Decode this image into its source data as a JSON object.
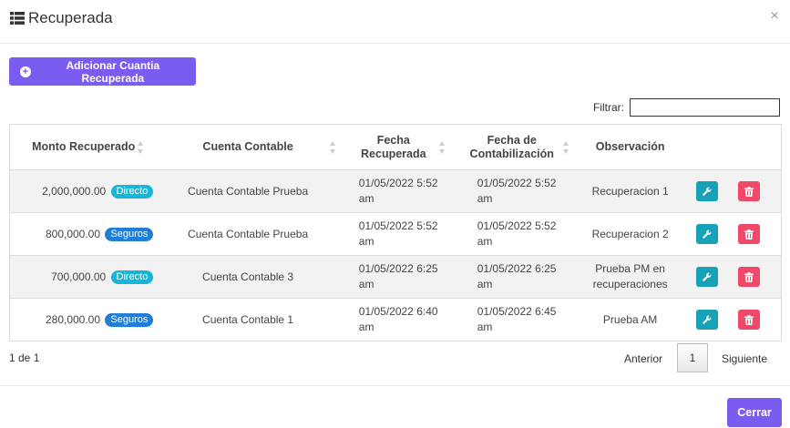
{
  "modal": {
    "title": "Recuperada",
    "title_icon": "list-icon",
    "close_glyph": "×"
  },
  "toolbar": {
    "add_label": "Adicionar Cuantia Recuperada",
    "add_icon": "plus-circle-icon"
  },
  "filter": {
    "label": "Filtrar:",
    "value": ""
  },
  "table": {
    "headers": {
      "monto": "Monto Recuperado",
      "cuenta": "Cuenta Contable",
      "fecha_rec": "Fecha Recuperada",
      "fecha_cont": "Fecha de Contabilización",
      "obs": "Observación"
    },
    "rows": [
      {
        "monto": "2,000,000.00",
        "tipo": "Directo",
        "cuenta": "Cuenta Contable Prueba",
        "fecha_rec": "01/05/2022 5:52 am",
        "fecha_cont": "01/05/2022 5:52 am",
        "obs": "Recuperacion 1"
      },
      {
        "monto": "800,000.00",
        "tipo": "Seguros",
        "cuenta": "Cuenta Contable Prueba",
        "fecha_rec": "01/05/2022 5:52 am",
        "fecha_cont": "01/05/2022 5:52 am",
        "obs": "Recuperacion 2"
      },
      {
        "monto": "700,000.00",
        "tipo": "Directo",
        "cuenta": "Cuenta Contable 3",
        "fecha_rec": "01/05/2022 6:25 am",
        "fecha_cont": "01/05/2022 6:25 am",
        "obs": "Prueba PM en recuperaciones"
      },
      {
        "monto": "280,000.00",
        "tipo": "Seguros",
        "cuenta": "Cuenta Contable 1",
        "fecha_rec": "01/05/2022 6:40 am",
        "fecha_cont": "01/05/2022 6:45 am",
        "obs": "Prueba AM"
      }
    ],
    "row_actions": {
      "edit_icon": "wrench-icon",
      "delete_icon": "trash-icon"
    }
  },
  "pagination": {
    "info": "1 de 1",
    "prev_label": "Anterior",
    "current_page": "1",
    "next_label": "Siguiente"
  },
  "footer": {
    "close_label": "Cerrar"
  },
  "colors": {
    "primary": "#7b5cf0",
    "badge_directo": "#17b6d8",
    "badge_seguros": "#1f7fd8",
    "edit": "#17a2b8",
    "delete": "#f04868"
  }
}
